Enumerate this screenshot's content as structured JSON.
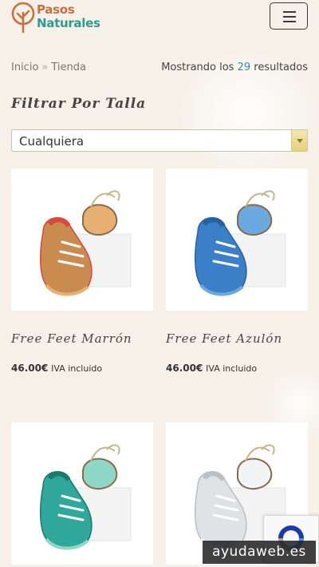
{
  "header": {
    "logo_line1": "Pasos",
    "logo_line2": "Naturales",
    "menu_icon": "hamburger-icon"
  },
  "breadcrumb": {
    "home": "Inicio",
    "separator": "»",
    "current": "Tienda"
  },
  "results": {
    "prefix": "Mostrando los ",
    "count": "29",
    "suffix": " resultados"
  },
  "filter": {
    "title": "Filtrar Por Talla",
    "selected": "Cualquiera"
  },
  "products": [
    {
      "name": "Free Feet Marrón",
      "price": "46.00€",
      "tax": "IVA incluido",
      "shoe_color": "#c98b4e",
      "sole_color": "#e8b070",
      "accent": "#d8483c"
    },
    {
      "name": "Free Feet Azulón",
      "price": "46.00€",
      "tax": "IVA incluido",
      "shoe_color": "#3a7fc8",
      "sole_color": "#6aa9e0",
      "accent": "#2a5fa0"
    },
    {
      "name": "",
      "price": "",
      "tax": "",
      "shoe_color": "#2fa79a",
      "sole_color": "#8fd8c8",
      "accent": "#1e7a70"
    },
    {
      "name": "",
      "price": "",
      "tax": "",
      "shoe_color": "#dfe3e6",
      "sole_color": "#f2f4f5",
      "accent": "#b8c0c6"
    }
  ],
  "colors": {
    "background": "#f6f0e8",
    "link_count": "#2e8bb8",
    "logo_orange": "#c96f3b",
    "logo_teal": "#2e9b8f"
  },
  "watermark": "ayudaweb.es"
}
